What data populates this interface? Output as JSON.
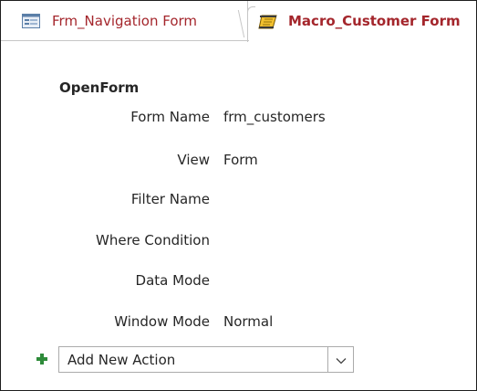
{
  "tabs": [
    {
      "label": "Frm_Navigation Form",
      "icon": "form-icon"
    },
    {
      "label": "Macro_Customer Form",
      "icon": "macro-scroll-icon",
      "active": true
    }
  ],
  "action": {
    "name": "OpenForm",
    "arguments": [
      {
        "label": "Form Name",
        "value": "frm_customers"
      },
      {
        "label": "View",
        "value": "Form"
      },
      {
        "label": "Filter Name",
        "value": ""
      },
      {
        "label": "Where Condition",
        "value": ""
      },
      {
        "label": "Data Mode",
        "value": ""
      },
      {
        "label": "Window Mode",
        "value": "Normal"
      }
    ]
  },
  "add_action": {
    "value": "Add New Action",
    "icon": "plus-icon",
    "dropdown_icon": "chevron-down-icon"
  },
  "colors": {
    "tab_text": "#a4262c",
    "plus": "#2e8b3a",
    "border": "#ababab",
    "text": "#262626"
  }
}
